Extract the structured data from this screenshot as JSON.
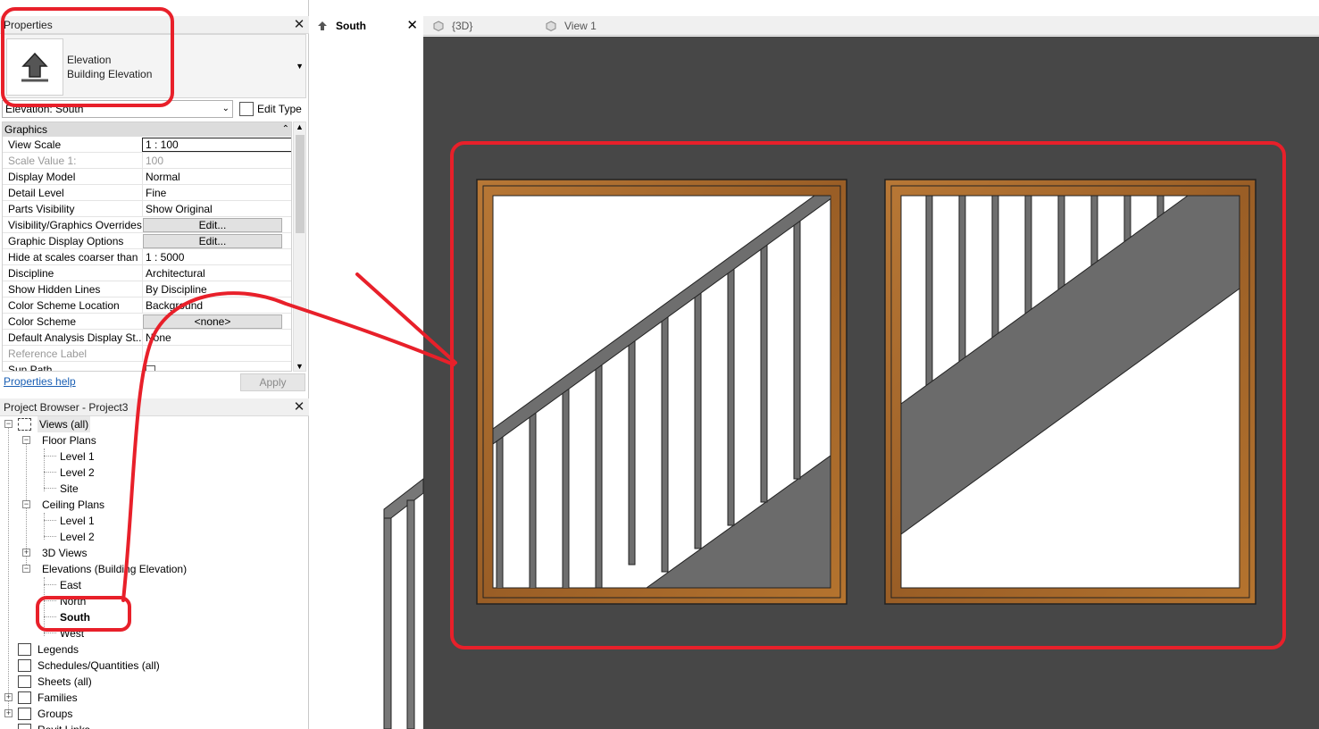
{
  "properties": {
    "title": "Properties",
    "type_name": "Elevation",
    "type_family": "Building Elevation",
    "instance_selector": "Elevation: South",
    "edit_type_label": "Edit Type",
    "group_header": "Graphics",
    "rows": [
      {
        "name": "View Scale",
        "value": "1 : 100"
      },
      {
        "name": "Scale Value    1:",
        "value": "100"
      },
      {
        "name": "Display Model",
        "value": "Normal"
      },
      {
        "name": "Detail Level",
        "value": "Fine"
      },
      {
        "name": "Parts Visibility",
        "value": "Show Original"
      },
      {
        "name": "Visibility/Graphics Overrides",
        "value": "Edit..."
      },
      {
        "name": "Graphic Display Options",
        "value": "Edit..."
      },
      {
        "name": "Hide at scales coarser than",
        "value": "1 : 5000"
      },
      {
        "name": "Discipline",
        "value": "Architectural"
      },
      {
        "name": "Show Hidden Lines",
        "value": "By Discipline"
      },
      {
        "name": "Color Scheme Location",
        "value": "Background"
      },
      {
        "name": "Color Scheme",
        "value": "<none>"
      },
      {
        "name": "Default Analysis Display St...",
        "value": "None"
      },
      {
        "name": "Reference Label",
        "value": ""
      },
      {
        "name": "Sun Path",
        "value": ""
      }
    ],
    "help_link": "Properties help",
    "apply_label": "Apply"
  },
  "project_browser": {
    "title": "Project Browser - Project3",
    "views_root": "Views (all)",
    "floor_plans": "Floor Plans",
    "floor_level1": "Level 1",
    "floor_level2": "Level 2",
    "floor_site": "Site",
    "ceiling_plans": "Ceiling Plans",
    "ceiling_level1": "Level 1",
    "ceiling_level2": "Level 2",
    "views_3d": "3D Views",
    "elevations": "Elevations (Building Elevation)",
    "elev_east": "East",
    "elev_north": "North",
    "elev_south": "South",
    "elev_west": "West",
    "legends": "Legends",
    "schedules": "Schedules/Quantities (all)",
    "sheets": "Sheets (all)",
    "families": "Families",
    "groups": "Groups",
    "revit_links": "Revit Links"
  },
  "tabs": [
    {
      "label": "South"
    },
    {
      "label": "{3D}"
    },
    {
      "label": "View 1"
    }
  ],
  "colors": {
    "canvas": "#474747",
    "annotation": "#e8202a",
    "frame_wood": "#a0652a"
  }
}
